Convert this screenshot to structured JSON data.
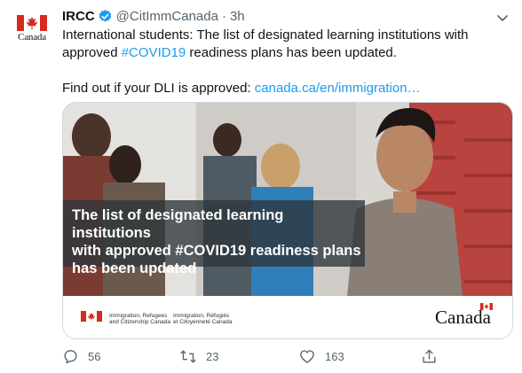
{
  "tweet": {
    "display_name": "IRCC",
    "handle": "@CitImmCanada",
    "separator": "·",
    "time": "3h",
    "avatar_wordmark": "Canada",
    "text_line1_part1": "International students: The list of designated learning institutions with approved ",
    "text_hashtag": "#COVID19",
    "text_line1_part2": " readiness plans has been updated.",
    "text_line2_prefix": "Find out if your DLI is approved: ",
    "text_link": "canada.ca/en/immigration…"
  },
  "card": {
    "overlay_lines": [
      "The list of designated learning institutions",
      "with approved #COVID19 readiness plans",
      "has been updated"
    ],
    "dept_en_lines": [
      "Immigration, Refugees",
      "and Citizenship Canada"
    ],
    "dept_fr_lines": [
      "Immigration, Réfugiés",
      "et Citoyenneté Canada"
    ],
    "wordmark": "Canada"
  },
  "actions": {
    "reply_count": "56",
    "retweet_count": "23",
    "like_count": "163"
  },
  "colors": {
    "accent": "#1d9bf0",
    "text": "#0f1419",
    "muted": "#536471",
    "canada_red": "#d52b1e"
  },
  "icons": [
    "maple-leaf-icon",
    "verified-badge-icon",
    "chevron-down-icon",
    "reply-icon",
    "retweet-icon",
    "like-icon",
    "share-icon"
  ]
}
